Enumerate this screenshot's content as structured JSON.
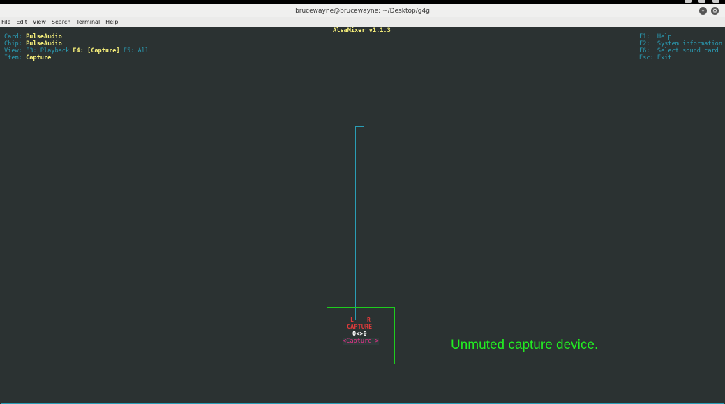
{
  "window": {
    "title": "brucewayne@brucewayne: ~/Desktop/g4g"
  },
  "menubar": {
    "items": [
      "File",
      "Edit",
      "View",
      "Search",
      "Terminal",
      "Help"
    ]
  },
  "alsamixer": {
    "frame_title": "AlsaMixer v1.1.3",
    "info": {
      "card_label": "Card:",
      "card_value": "PulseAudio",
      "chip_label": "Chip:",
      "chip_value": "PulseAudio",
      "view_label": "View:",
      "view_f3": "F3: Playback",
      "view_f4": "F4: [Capture]",
      "view_f5": "F5: All",
      "item_label": "Item:",
      "item_value": "Capture"
    },
    "keys": [
      {
        "key": "F1:",
        "action": "Help"
      },
      {
        "key": "F2:",
        "action": "System information"
      },
      {
        "key": "F6:",
        "action": "Select sound card"
      },
      {
        "key": "Esc:",
        "action": "Exit"
      }
    ],
    "control": {
      "left_channel": "L",
      "right_channel": "R",
      "capture_tag": "CAPTURE",
      "volume_readout": "0<>0",
      "name": "<Capture >",
      "volume_level": 0
    }
  },
  "annotation": "Unmuted capture device.",
  "colors": {
    "background": "#2b3232",
    "label": "#2a9db5",
    "value": "#f5ee7a",
    "capture": "#e23b3b",
    "control_box": "#1ecc1e",
    "annotation": "#22ee22"
  }
}
